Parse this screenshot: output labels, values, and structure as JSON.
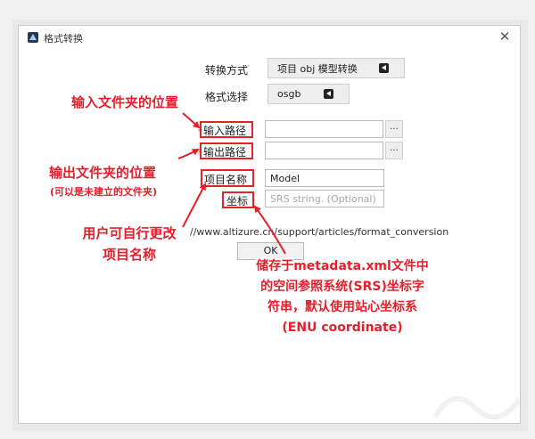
{
  "window": {
    "title": "格式转换",
    "close_glyph": "✕"
  },
  "form": {
    "conversion_method": {
      "label": "转换方式",
      "value": "项目 obj 模型转换"
    },
    "format_select": {
      "label": "格式选择",
      "value": "osgb"
    },
    "input_path": {
      "label": "输入路径",
      "value": "",
      "browse_label": "..."
    },
    "output_path": {
      "label": "输出路径",
      "value": "",
      "browse_label": "..."
    },
    "project_name": {
      "label": "项目名称",
      "value": "Model"
    },
    "coordinate": {
      "label": "坐标",
      "placeholder": "SRS string. (Optional)"
    },
    "required_mark": "*",
    "help_url": "//www.altizure.cn/support/articles/format_conversion",
    "ok_label": "OK"
  },
  "annotations": {
    "input_folder": "输入文件夹的位置",
    "output_folder": "输出文件夹的位置",
    "output_folder_note": "(可以是未建立的文件夹)",
    "project_name_note": [
      "用户可自行更改",
      "项目名称"
    ],
    "srs_note": [
      "储存于metadata.xml文件中",
      "的空间参照系统(SRS)坐标字",
      "符串，默认使用站心坐标系",
      "(ENU coordinate)"
    ]
  },
  "colors": {
    "annotation_red": "#e51f2b",
    "highlight_red": "#e0242b"
  },
  "icons": {
    "app": "app-logo-icon",
    "dropdown_arrow": "left-arrow-icon",
    "close": "close-icon"
  }
}
